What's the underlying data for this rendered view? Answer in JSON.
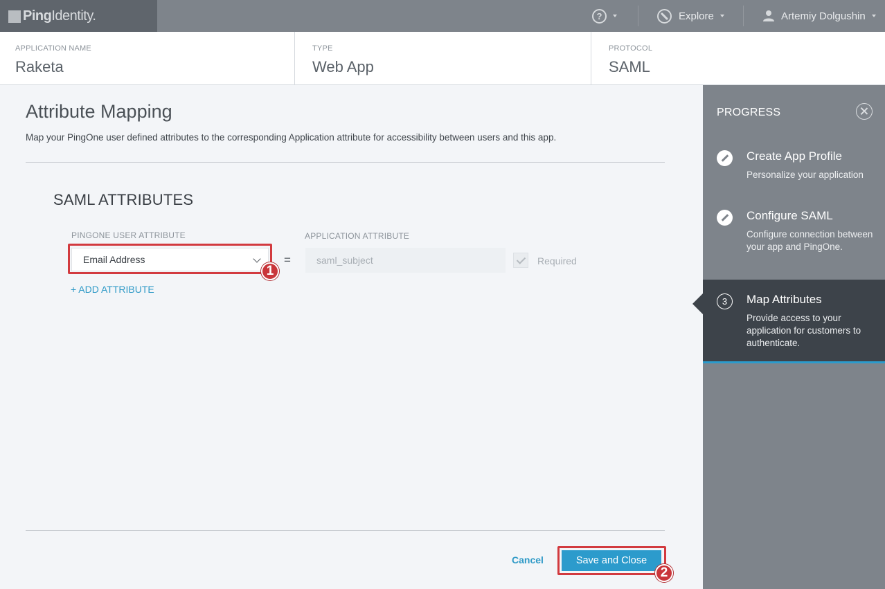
{
  "topbar": {
    "logo_bold": "Ping",
    "logo_light": "Identity.",
    "help_icon_label": "?",
    "explore_label": "Explore",
    "user_name": "Artemiy Dolgushin"
  },
  "info": {
    "app_name_label": "APPLICATION NAME",
    "app_name_value": "Raketa",
    "type_label": "TYPE",
    "type_value": "Web App",
    "protocol_label": "PROTOCOL",
    "protocol_value": "SAML"
  },
  "main": {
    "title": "Attribute Mapping",
    "description": "Map your PingOne user defined attributes to the corresponding Application attribute for accessibility between users and this app.",
    "section_title": "SAML ATTRIBUTES",
    "pingone_col_label": "PINGONE USER ATTRIBUTE",
    "app_col_label": "APPLICATION ATTRIBUTE",
    "mapping": {
      "user_attribute": "Email Address",
      "equals": "=",
      "app_attribute": "saml_subject",
      "required_label": "Required",
      "required_checked": true
    },
    "add_attribute": "+ ADD ATTRIBUTE",
    "cancel": "Cancel",
    "save": "Save and Close",
    "annotation_1": "1",
    "annotation_2": "2"
  },
  "progress": {
    "title": "PROGRESS",
    "steps": [
      {
        "title": "Create App Profile",
        "desc": "Personalize your application",
        "state": "done"
      },
      {
        "title": "Configure SAML",
        "desc": "Configure connection between your app and PingOne.",
        "state": "done"
      },
      {
        "number": "3",
        "title": "Map Attributes",
        "desc": "Provide access to your application for customers to authenticate.",
        "state": "active"
      }
    ]
  },
  "colors": {
    "accent": "#2c9bcc",
    "topbar": "#7e848b",
    "highlight": "#d23a3f",
    "active_step": "#3d434a"
  }
}
